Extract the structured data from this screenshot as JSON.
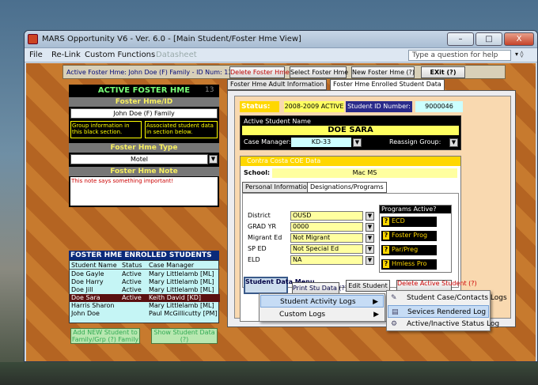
{
  "window": {
    "title": "MARS Opportunity V6 - Ver. 6.0 - [Main Student/Foster Hme View]"
  },
  "controls": {
    "minimize": "–",
    "maximize": "□",
    "close": "X"
  },
  "menubar": {
    "items": [
      "File",
      "Re-Link",
      "Custom Functions",
      "Datasheet"
    ],
    "help_placeholder": "Type a question for help"
  },
  "header": {
    "active_label": "Active Foster Hme:  John Doe (F) Family - ID Num: 13",
    "buttons": [
      "Delete Foster Hme",
      "Select Foster Hme",
      "New Foster Hme (?)",
      "EXit (?)"
    ]
  },
  "left": {
    "active_title": "ACTIVE FOSTER HME",
    "active_num": "13",
    "id_heading": "Foster Hme/ID",
    "family": "John Doe (F) Family",
    "note1": "Group information in this black  section.",
    "note2": "Associated student data in  section below.",
    "type_heading": "Foster Hme Type",
    "type_value": "Motel",
    "note_heading": "Foster Hme Note",
    "note_text": "This note says something important!"
  },
  "enrolled": {
    "title": "FOSTER HME ENROLLED STUDENTS",
    "headers": [
      "Student Name",
      "Status",
      "Case Manager"
    ],
    "rows": [
      [
        "Doe Gayle",
        "Active",
        "Mary Littlelamb [ML]"
      ],
      [
        "Doe Harry",
        "Active",
        "Mary Littlelamb [ML]"
      ],
      [
        "Doe Jill",
        "Active",
        "Mary Littlelamb [ML]"
      ],
      [
        "Doe Sara",
        "Active",
        "Keith David [KD]"
      ],
      [
        "Harris Sharon",
        "",
        "Mary Littlelamb [ML]"
      ],
      [
        "John Doe",
        "",
        "Paul McGillicutty [PM]"
      ]
    ],
    "add_btn": "Add NEW Student to Family/Grp (?) Family",
    "show_btn": "Show Student Data (?)"
  },
  "tabs": [
    "Foster Hme Adult Information",
    "Foster Hme Enrolled Student Data"
  ],
  "student": {
    "status_label": "Status:",
    "status_value": "2008-2009 ACTIVE",
    "id_label": "Student ID Number:",
    "id_value": "9000046",
    "name_label": "Active Student Name",
    "name": "DOE SARA",
    "cm_label": "Case Manager:",
    "cm_value": "KD-33",
    "reassign": "Reassign  Group:"
  },
  "ccoe": {
    "title": "Contra Costa COE Data",
    "school_label": "School:",
    "school": "Mac MS",
    "subtabs": [
      "Personal Information",
      "Designations/Programs"
    ],
    "fields": [
      [
        "District",
        "OUSD"
      ],
      [
        "GRAD YR",
        "0000"
      ],
      [
        "Migrant Ed",
        "Not Migrant"
      ],
      [
        "SP ED",
        "Not Special Ed"
      ],
      [
        "ELD",
        "NA"
      ]
    ],
    "prog_title": "Programs Active?",
    "programs": [
      "ECD",
      "Foster Prog",
      "Par/Preg",
      "Hmless Pro"
    ]
  },
  "bottom_buttons": [
    "Student Data Menu",
    "Print Stu Data (?)",
    "Edit Student",
    "Delete Active Student (?)"
  ],
  "context_menu": [
    "Student Activity Logs",
    "Custom Logs"
  ],
  "submenu": [
    "Student Case/Contacts Logs",
    "Sevices Rendered Log",
    "Active/Inactive Status Log"
  ]
}
